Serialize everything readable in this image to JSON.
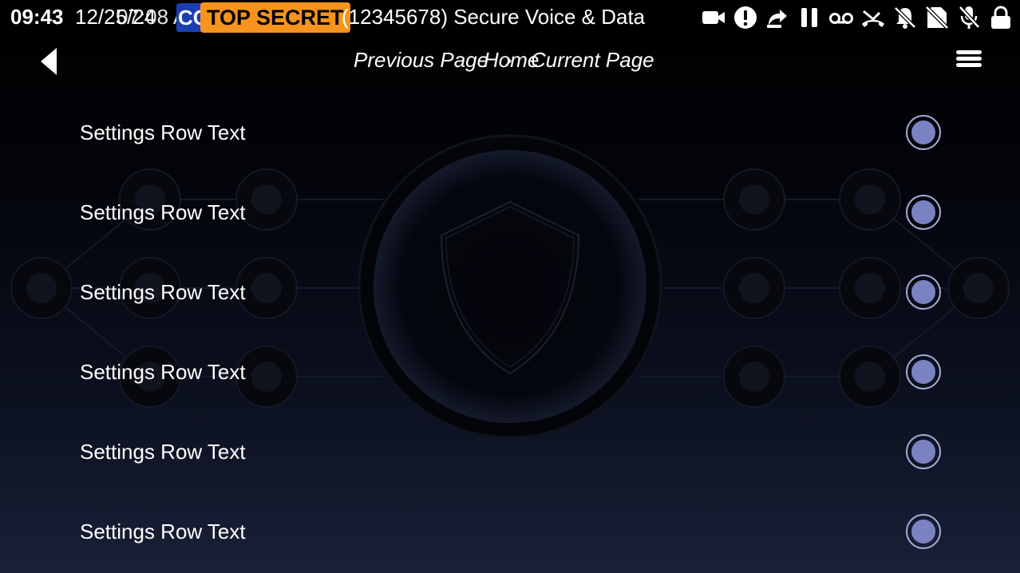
{
  "status_bar": {
    "time": "09:43",
    "date": "12/25/24",
    "date_overlap": "07:08 AM",
    "class_blue": "CO",
    "classification": "TOP SECRET",
    "title": "(12345678) Secure Voice & Data",
    "icons": [
      "video-camera-icon",
      "alert-icon",
      "call-forward-icon",
      "pause-icon",
      "voicemail-icon",
      "missed-call-icon",
      "notifications-off-icon",
      "no-sim-icon",
      "mic-off-icon",
      "lock-icon"
    ]
  },
  "nav": {
    "back_icon": "back-arrow-icon",
    "breadcrumb": {
      "previous": "Previous Page",
      "separator": "›",
      "home": "Home",
      "current": "Current Page"
    },
    "menu_icon": "hamburger-menu-icon"
  },
  "settings": {
    "rows": [
      {
        "label": "Settings Row Text"
      },
      {
        "label": "Settings Row Text"
      },
      {
        "label": "Settings Row Text"
      },
      {
        "label": "Settings Row Text"
      },
      {
        "label": "Settings Row Text"
      },
      {
        "label": "Settings Row Text"
      }
    ]
  },
  "colors": {
    "classification_bg": "#f7941d",
    "classification_blue": "#1c3fb0",
    "radio_ring": "#a7acd8",
    "radio_dot": "#7b82c2",
    "background_bottom": "#1a2038"
  }
}
